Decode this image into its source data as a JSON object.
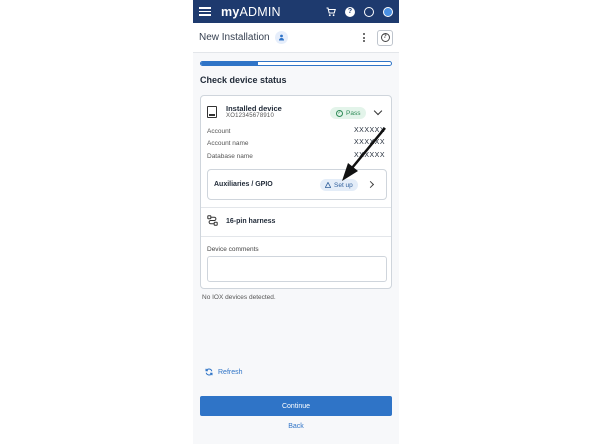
{
  "app": {
    "logo_my": "my",
    "logo_admin": "ADMIN"
  },
  "header": {
    "title": "New Installation"
  },
  "progress": {
    "fraction": 0.3
  },
  "section": {
    "title": "Check device status"
  },
  "device": {
    "name": "Installed device",
    "serial": "XO12345678910",
    "status": "Pass",
    "fields": [
      {
        "label": "Account",
        "value": "XXXXXX"
      },
      {
        "label": "Account name",
        "value": "XXXXXX"
      },
      {
        "label": "Database name",
        "value": "XXXXXX"
      }
    ]
  },
  "aux": {
    "label": "Auxiliaries / GPIO",
    "action": "Set up"
  },
  "harness": {
    "label": "16-pin harness"
  },
  "comments": {
    "label": "Device comments",
    "value": "",
    "placeholder": ""
  },
  "iox": {
    "message": "No IOX devices detected."
  },
  "actions": {
    "refresh": "Refresh",
    "continue": "Continue",
    "back": "Back"
  },
  "colors": {
    "topbar": "#1e3a6e",
    "primary": "#2f74c7",
    "pass_bg": "#e3f4ea",
    "pass_text": "#2e8b57"
  }
}
